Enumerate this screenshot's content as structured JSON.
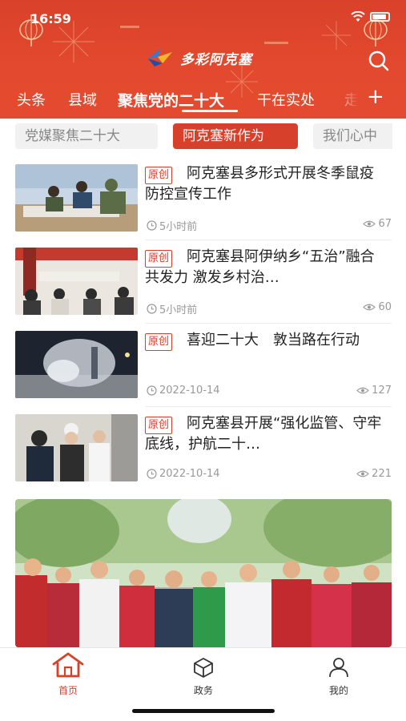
{
  "status_bar": {
    "time": "16:59"
  },
  "brand": {
    "name": "多彩阿克塞"
  },
  "channels": [
    {
      "label": "头条"
    },
    {
      "label": "县域"
    },
    {
      "label": "聚焦党的二十大",
      "active": true
    },
    {
      "label": "干在实处"
    },
    {
      "label": "走"
    }
  ],
  "channel_add": "+",
  "subtabs": [
    {
      "label": "党媒聚焦二十大"
    },
    {
      "label": "阿克塞新作为",
      "active": true
    },
    {
      "label": "我们心中"
    }
  ],
  "news": [
    {
      "badge": "原创",
      "title": "阿克塞县多形式开展冬季鼠疫防控宣传工作",
      "time": "5小时前",
      "views": "67"
    },
    {
      "badge": "原创",
      "title": "阿克塞县阿伊纳乡“五治”融合共发力 激发乡村治…",
      "time": "5小时前",
      "views": "60"
    },
    {
      "badge": "原创",
      "title": "喜迎二十大　敦当路在行动",
      "time": "2022-10-14",
      "views": "127"
    },
    {
      "badge": "原创",
      "title": "阿克塞县开展“强化监管、守牢底线，护航二十…",
      "time": "2022-10-14",
      "views": "221"
    }
  ],
  "bottom_tabs": [
    {
      "label": "首页",
      "icon": "home-icon",
      "active": true
    },
    {
      "label": "政务",
      "icon": "government-cube-icon"
    },
    {
      "label": "我的",
      "icon": "user-icon"
    }
  ],
  "colors": {
    "header_red": "#e44a2f",
    "accent_red": "#d7412b",
    "chip_gray": "#f1f1f1"
  }
}
